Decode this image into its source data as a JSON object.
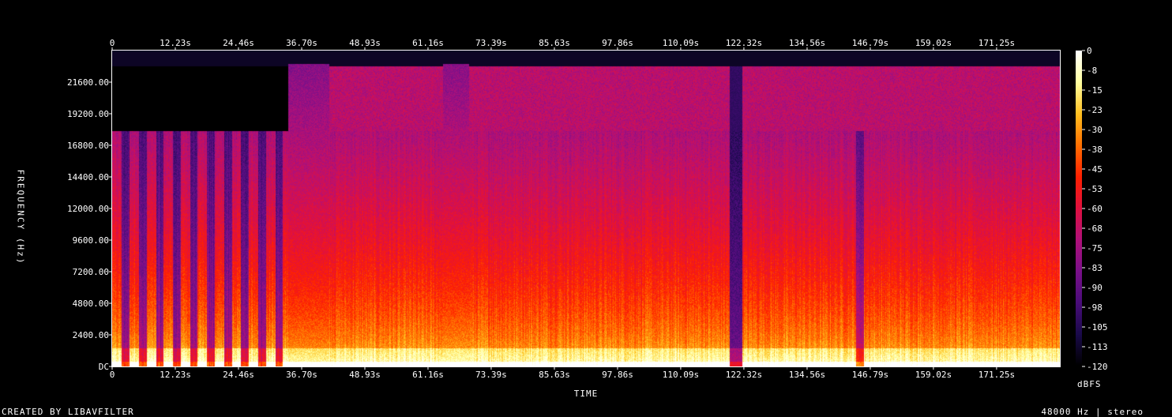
{
  "chart_data": {
    "type": "heatmap",
    "title": "",
    "xlabel": "TIME",
    "ylabel": "FREQUENCY (Hz)",
    "x_ticks": [
      "0",
      "12.23s",
      "24.46s",
      "36.70s",
      "48.93s",
      "61.16s",
      "73.39s",
      "85.63s",
      "97.86s",
      "110.09s",
      "122.32s",
      "134.56s",
      "146.79s",
      "159.02s",
      "171.25s"
    ],
    "x_tick_values": [
      0,
      12.23,
      24.46,
      36.7,
      48.93,
      61.16,
      73.39,
      85.63,
      97.86,
      110.09,
      122.32,
      134.56,
      146.79,
      159.02,
      171.25
    ],
    "xlim": [
      0,
      183.5
    ],
    "y_ticks": [
      "DC",
      "2400.00",
      "4800.00",
      "7200.00",
      "9600.00",
      "12000.00",
      "14400.00",
      "16800.00",
      "19200.00",
      "21600.00"
    ],
    "y_tick_values": [
      0,
      2400,
      4800,
      7200,
      9600,
      12000,
      14400,
      16800,
      19200,
      21600
    ],
    "ylim": [
      0,
      24000
    ],
    "colorbar": {
      "label": "dBFS",
      "ticks": [
        "0",
        "-8",
        "-15",
        "-23",
        "-30",
        "-38",
        "-45",
        "-53",
        "-60",
        "-68",
        "-75",
        "-83",
        "-90",
        "-98",
        "-105",
        "-113",
        "-120"
      ],
      "range": [
        -120,
        0
      ],
      "colors": [
        "#000000",
        "#1a0a4a",
        "#4a0d7a",
        "#7a108a",
        "#b0107a",
        "#e01040",
        "#ff2000",
        "#ff7000",
        "#ffc020",
        "#ffffa0",
        "#ffffff"
      ]
    },
    "grid": false,
    "legend": "right"
  },
  "footer": {
    "left": "CREATED BY LIBAVFILTER",
    "right": "48000 Hz | stereo"
  }
}
